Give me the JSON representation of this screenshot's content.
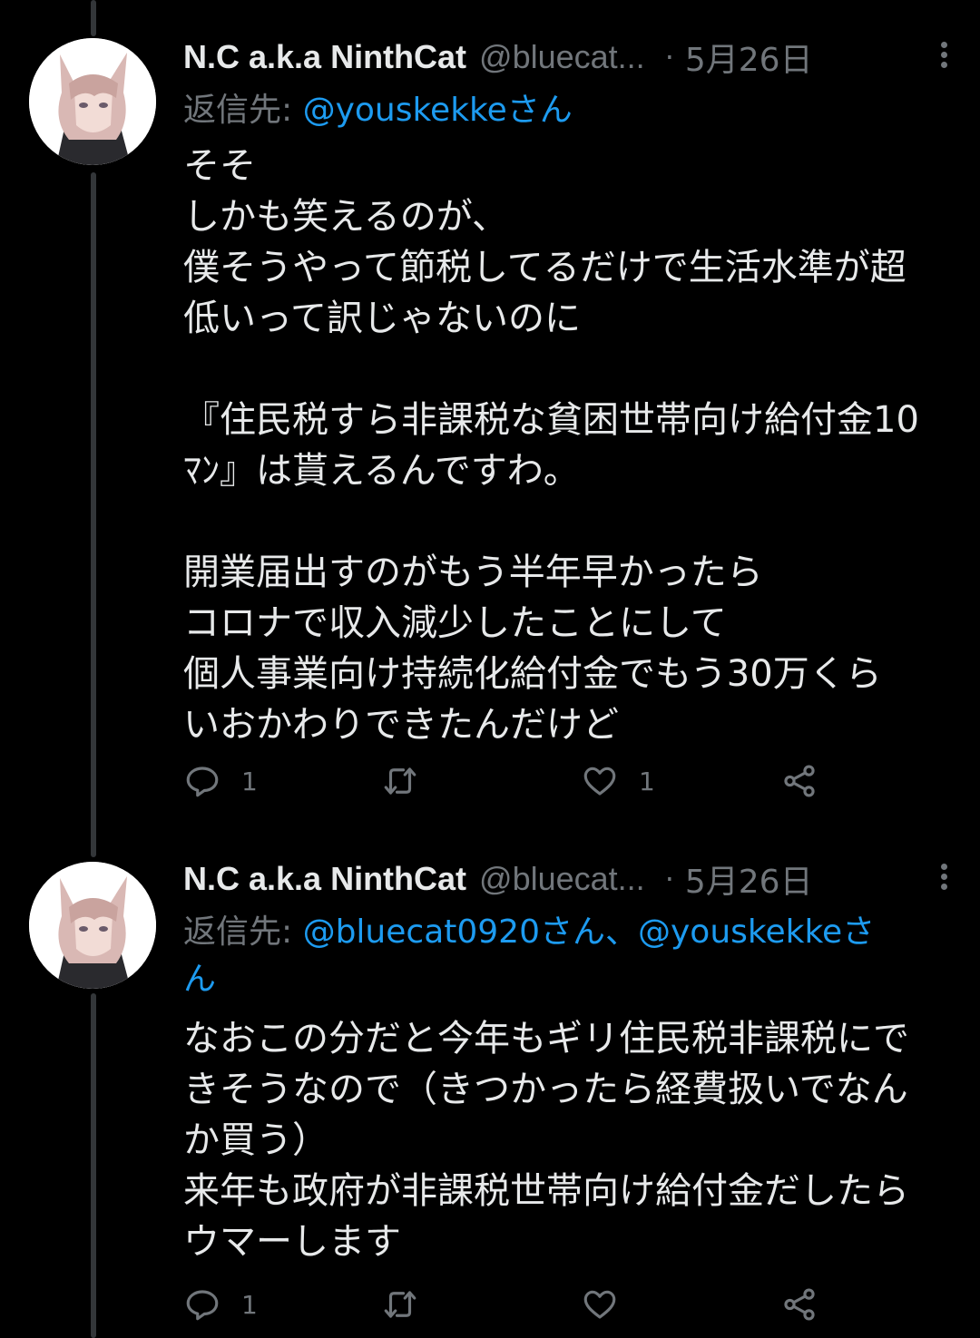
{
  "tweets": [
    {
      "author": {
        "display_name": "N.C a.k.a NinthCat",
        "handle": "@bluecat..."
      },
      "separator": "·",
      "date": "5月26日",
      "reply_to": {
        "prefix": "返信先: ",
        "mention1": "@youskekkeさん",
        "mention2": ""
      },
      "text_lines": [
        "そそ",
        "しかも笑えるのが、",
        "僕そうやって節税してるだけで生活水準が超",
        "低いって訳じゃないのに",
        "",
        "『住民税すら非課税な貧困世帯向け給付金10",
        "ﾏﾝ』は貰えるんですわ。",
        "",
        "開業届出すのがもう半年早かったら",
        "コロナで収入減少したことにして",
        "個人事業向け持続化給付金でもう30万くら",
        "いおかわりできたんだけど"
      ],
      "actions": {
        "reply_icon": "reply-icon",
        "reply_count": "1",
        "retweet_icon": "retweet-icon",
        "retweet_count": "",
        "like_icon": "heart-icon",
        "like_count": "1",
        "share_icon": "share-icon"
      }
    },
    {
      "author": {
        "display_name": "N.C a.k.a NinthCat",
        "handle": "@bluecat..."
      },
      "separator": "·",
      "date": "5月26日",
      "reply_to": {
        "prefix": "返信先: ",
        "mention1": "@bluecat0920さん、@youskekkeさ",
        "mention2": "ん"
      },
      "text_lines": [
        "なおこの分だと今年もギリ住民税非課税にで",
        "きそうなので（きつかったら経費扱いでなん",
        "か買う）",
        "来年も政府が非課税世帯向け給付金だしたら",
        "ウマーします"
      ],
      "actions": {
        "reply_icon": "reply-icon",
        "reply_count": "1",
        "retweet_icon": "retweet-icon",
        "retweet_count": "",
        "like_icon": "heart-icon",
        "like_count": "",
        "share_icon": "share-icon"
      }
    }
  ],
  "colors": {
    "background": "#000000",
    "text": "#e7e9ea",
    "muted": "#71767b",
    "link": "#1d9bf0"
  }
}
